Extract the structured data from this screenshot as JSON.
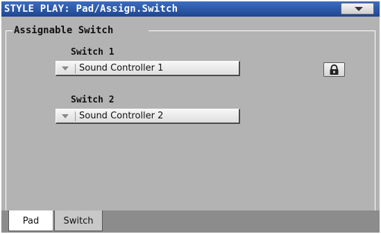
{
  "titlebar": {
    "title": "STYLE PLAY: Pad/Assign.Switch"
  },
  "menu": {
    "icon": "chevron-down-icon"
  },
  "group": {
    "title": "Assignable Switch"
  },
  "switches": [
    {
      "label": "Switch 1",
      "value": "Sound Controller 1"
    },
    {
      "label": "Switch 2",
      "value": "Sound Controller 2"
    }
  ],
  "lock": {
    "icon": "lock-icon"
  },
  "tabs": [
    {
      "label": "Pad"
    },
    {
      "label": "Switch"
    }
  ]
}
